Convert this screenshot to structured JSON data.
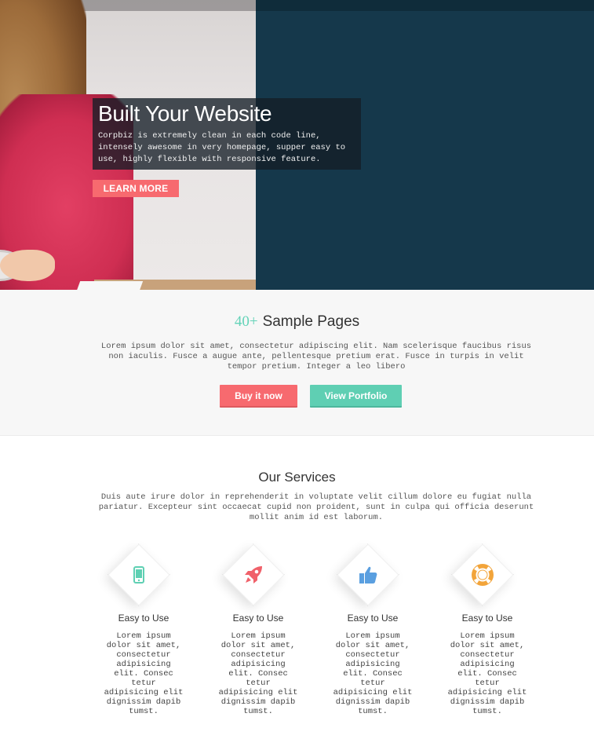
{
  "hero": {
    "title": "Built Your Website",
    "text": "Corpbiz is extremely clean in each code line, intensely awesome in very homepage, supper easy to use, highly flexible with responsive feature.",
    "cta_label": "LEARN MORE"
  },
  "samples": {
    "title_highlight": "40+",
    "title_rest": "Sample Pages",
    "text": "Lorem ipsum dolor sit amet, consectetur adipiscing elit. Nam scelerisque faucibus risus non iaculis. Fusce a augue ante, pellentesque pretium erat. Fusce in turpis in velit tempor pretium. Integer a leo libero",
    "buy_label": "Buy it now",
    "portfolio_label": "View Portfolio"
  },
  "services": {
    "title": "Our Services",
    "text": "Duis aute irure dolor in reprehenderit in voluptate velit cillum dolore eu fugiat nulla pariatur. Excepteur sint occaecat cupid non proident, sunt in culpa qui officia deserunt mollit anim id est laborum.",
    "items": [
      {
        "icon": "mobile-icon",
        "title": "Easy to Use",
        "text": "Lorem ipsum dolor sit amet, consectetur adipisicing elit. Consec tetur adipisicing elit dignissim dapib tumst."
      },
      {
        "icon": "rocket-icon",
        "title": "Easy to Use",
        "text": "Lorem ipsum dolor sit amet, consectetur adipisicing elit. Consec tetur adipisicing elit dignissim dapib tumst."
      },
      {
        "icon": "thumbs-up-icon",
        "title": "Easy to Use",
        "text": "Lorem ipsum dolor sit amet, consectetur adipisicing elit. Consec tetur adipisicing elit dignissim dapib tumst."
      },
      {
        "icon": "lifebuoy-icon",
        "title": "Easy to Use",
        "text": "Lorem ipsum dolor sit amet, consectetur adipisicing elit. Consec tetur adipisicing elit dignissim dapib tumst."
      }
    ]
  },
  "colors": {
    "accent_red": "#f76a6f",
    "accent_teal": "#5fcfb3",
    "hero_dark": "#15384b",
    "icon_teal": "#5fd0b3",
    "icon_red": "#f0616a",
    "icon_blue": "#5a9fe0",
    "icon_orange": "#f2a43a"
  }
}
